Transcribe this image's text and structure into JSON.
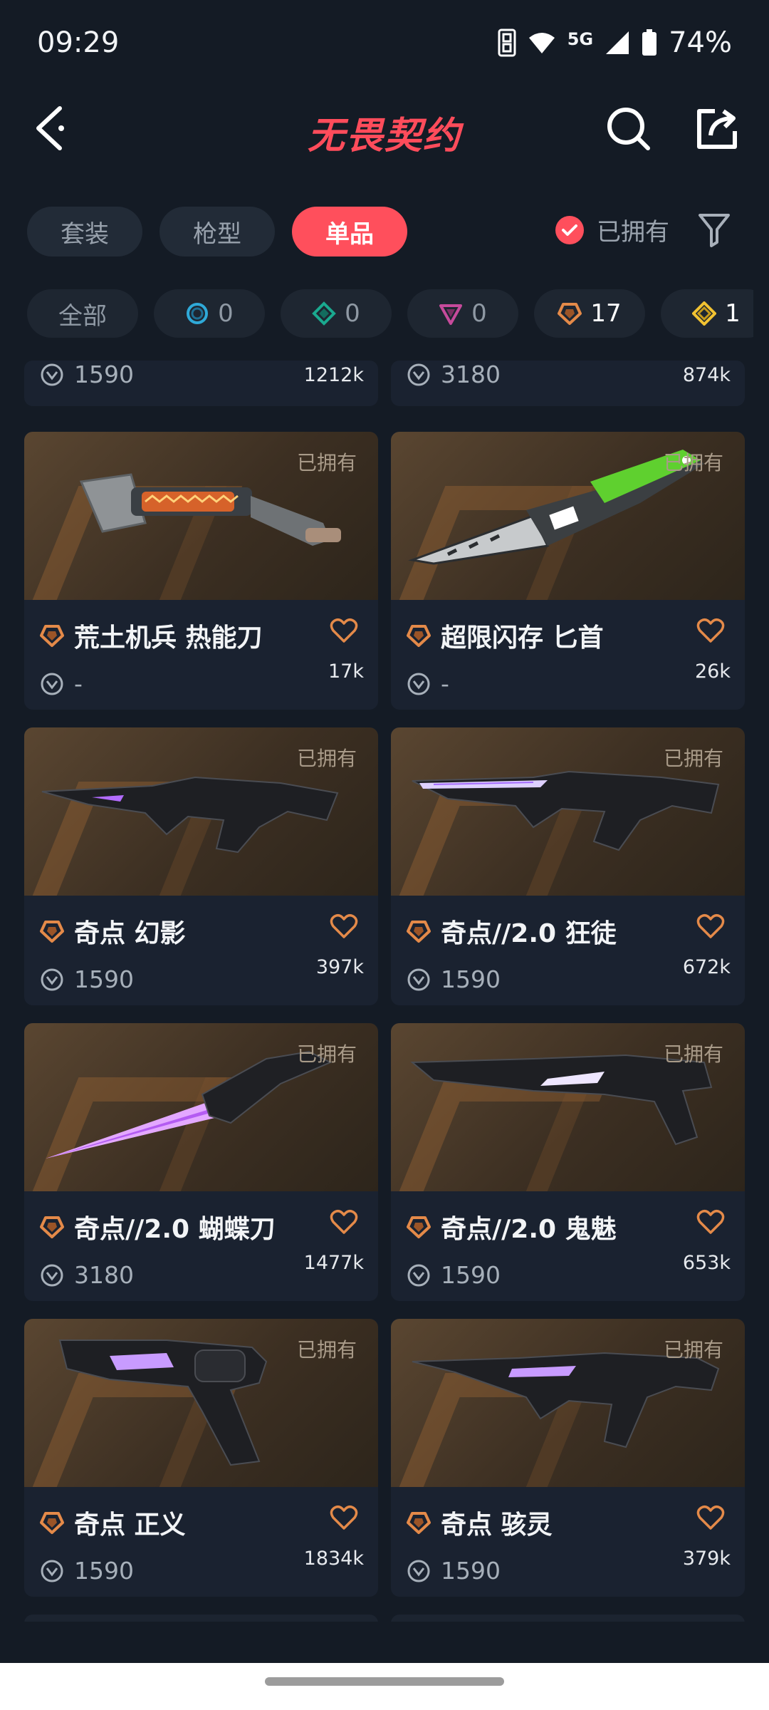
{
  "status_bar": {
    "time": "09:29",
    "network": "5G",
    "battery": "74%"
  },
  "header": {
    "title": "无畏契约"
  },
  "tabs": [
    {
      "label": "套装",
      "active": false
    },
    {
      "label": "枪型",
      "active": false
    },
    {
      "label": "单品",
      "active": true
    }
  ],
  "owned_toggle": {
    "label": "已拥有",
    "checked": true
  },
  "rarity_chips": [
    {
      "label": "全部",
      "count": "",
      "icon": "all"
    },
    {
      "label": "",
      "count": "0",
      "icon": "select-tier-icon",
      "color": "#2fa9d8"
    },
    {
      "label": "",
      "count": "0",
      "icon": "deluxe-tier-icon",
      "color": "#1aa98f"
    },
    {
      "label": "",
      "count": "0",
      "icon": "premium-tier-icon",
      "color": "#c64a9b"
    },
    {
      "label": "",
      "count": "17",
      "icon": "exclusive-tier-icon",
      "color": "#e48a49"
    },
    {
      "label": "",
      "count": "1",
      "icon": "ultra-tier-icon",
      "color": "#f1c232"
    }
  ],
  "accent_color": "#ff4f5c",
  "owned_label": "已拥有",
  "partial_row": [
    {
      "price": "1590",
      "likes": "1212k"
    },
    {
      "price": "3180",
      "likes": "874k"
    }
  ],
  "items": [
    {
      "name": "荒土机兵 热能刀",
      "price": "-",
      "likes": "17k",
      "owned": true,
      "weapon": "wasteland-knife"
    },
    {
      "name": "超限闪存 匕首",
      "price": "-",
      "likes": "26k",
      "owned": true,
      "weapon": "green-dagger"
    },
    {
      "name": "奇点 幻影",
      "price": "1590",
      "likes": "397k",
      "owned": true,
      "weapon": "singularity-rifle"
    },
    {
      "name": "奇点//2.0 狂徒",
      "price": "1590",
      "likes": "672k",
      "owned": true,
      "weapon": "singularity-rifle-2"
    },
    {
      "name": "奇点//2.0 蝴蝶刀",
      "price": "3180",
      "likes": "1477k",
      "owned": true,
      "weapon": "singularity-knife"
    },
    {
      "name": "奇点//2.0 鬼魅",
      "price": "1590",
      "likes": "653k",
      "owned": true,
      "weapon": "singularity-pistol"
    },
    {
      "name": "奇点 正义",
      "price": "1590",
      "likes": "1834k",
      "owned": true,
      "weapon": "singularity-revolver"
    },
    {
      "name": "奇点 骇灵",
      "price": "1590",
      "likes": "379k",
      "owned": true,
      "weapon": "singularity-smg"
    }
  ]
}
